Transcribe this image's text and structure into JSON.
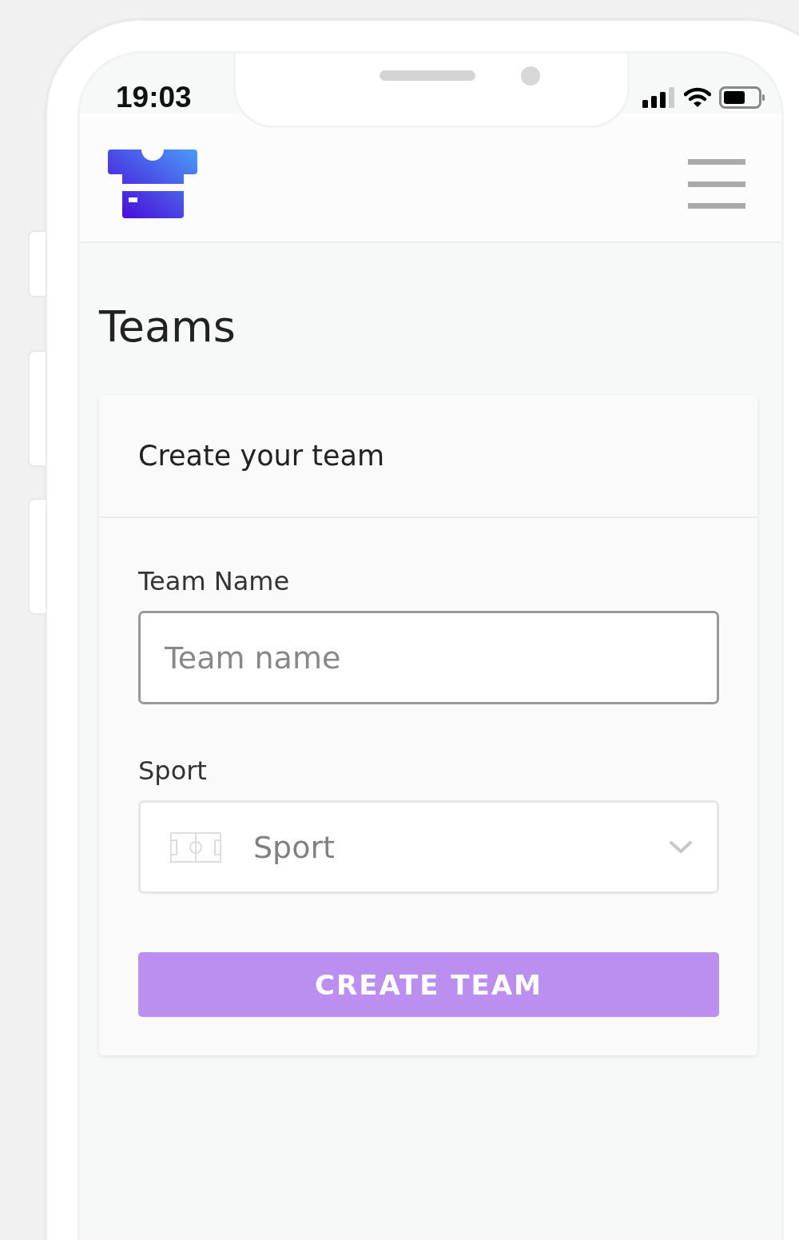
{
  "status_bar": {
    "time": "19:03"
  },
  "page": {
    "title": "Teams"
  },
  "card": {
    "title": "Create your team",
    "fields": [
      {
        "kind": "text",
        "label": "Team Name",
        "placeholder": "Team name"
      },
      {
        "kind": "select",
        "label": "Sport",
        "placeholder": "Sport"
      }
    ],
    "button": {
      "label": "CREATE TEAM",
      "disabled": true
    }
  }
}
